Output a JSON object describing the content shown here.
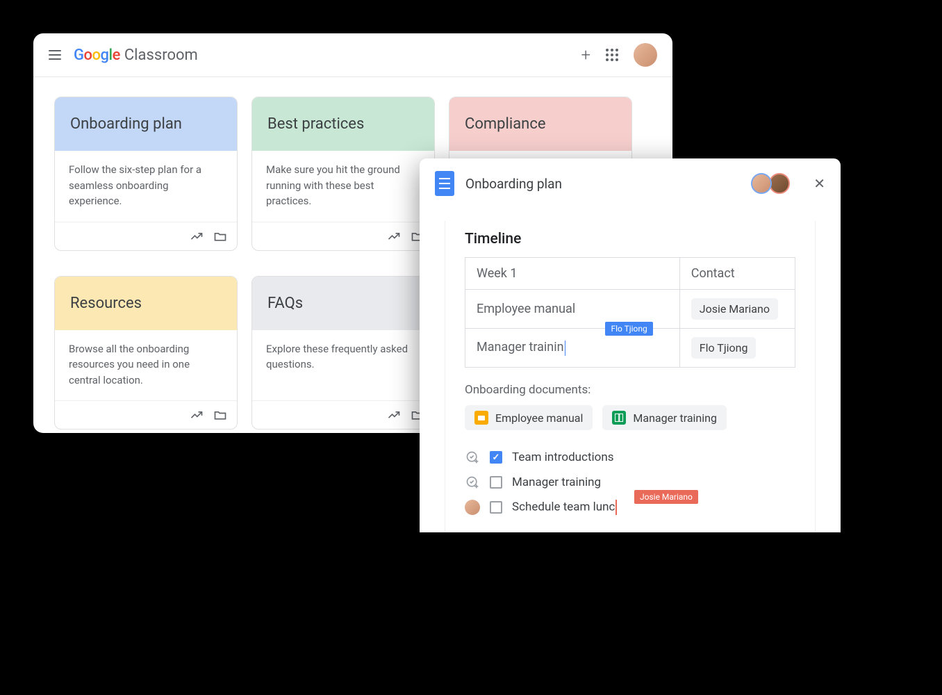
{
  "classroom": {
    "app_name": "Classroom",
    "logo": "Google",
    "cards": [
      {
        "title": "Onboarding plan",
        "color": "blue",
        "desc": "Follow the six-step plan for a seamless onboarding experience."
      },
      {
        "title": "Best practices",
        "color": "green",
        "desc": "Make sure you hit the ground running with these best practices."
      },
      {
        "title": "Compliance",
        "color": "pink",
        "desc": ""
      },
      {
        "title": "Resources",
        "color": "yellow",
        "desc": "Browse all the onboarding resources you need in one central location."
      },
      {
        "title": "FAQs",
        "color": "grey",
        "desc": "Explore these frequently asked questions."
      }
    ]
  },
  "docs": {
    "title": "Onboarding plan",
    "collaborators": [
      "Josie Mariano",
      "Flo Tjiong"
    ],
    "timeline_heading": "Timeline",
    "table": {
      "rows": [
        {
          "col1": "Week 1",
          "col2": "Contact"
        },
        {
          "col1": "Employee manual",
          "col2_chip": "Josie Mariano"
        },
        {
          "col1": "Manager trainin",
          "col2_chip": "Flo Tjiong",
          "cursor_name": "Flo Tjiong"
        }
      ]
    },
    "onboarding_docs_label": "Onboarding documents:",
    "doc_chips": [
      {
        "icon": "slides",
        "label": "Employee manual"
      },
      {
        "icon": "sheets",
        "label": "Manager training"
      }
    ],
    "checklist": [
      {
        "left": "add-check",
        "checked": true,
        "label": "Team introductions"
      },
      {
        "left": "add-check",
        "checked": false,
        "label": "Manager training"
      },
      {
        "left": "avatar",
        "checked": false,
        "label": "Schedule team lunc",
        "cursor_name": "Josie Mariano"
      }
    ]
  }
}
